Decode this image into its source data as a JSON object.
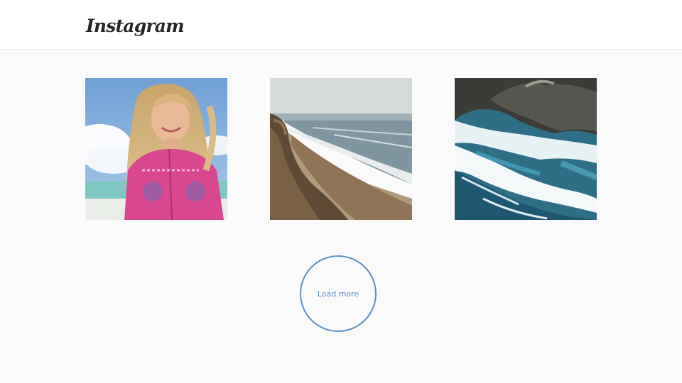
{
  "header": {
    "logo_text": "Instagram"
  },
  "feed": {
    "photos": [
      {
        "subject": "woman-portrait-photo"
      },
      {
        "subject": "beach-coastline-photo"
      },
      {
        "subject": "rocky-ocean-waves-photo"
      }
    ]
  },
  "load_more": {
    "label": "Load more",
    "accent_color": "#5b8fc4"
  },
  "colors": {
    "background": "#fafafa",
    "header_background": "#ffffff",
    "logo": "#262626"
  }
}
